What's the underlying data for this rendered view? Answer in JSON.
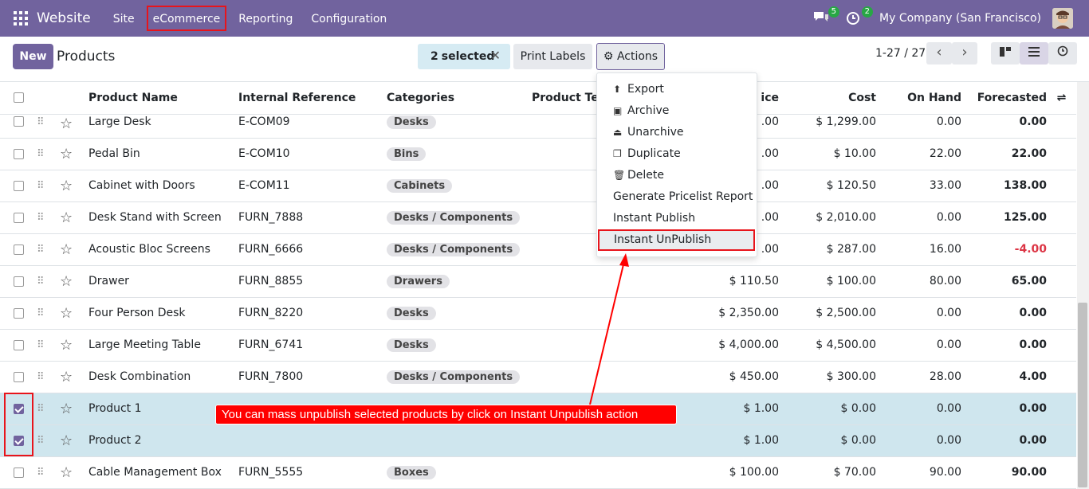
{
  "nav": {
    "brand": "Website",
    "menu": [
      "Site",
      "eCommerce",
      "Reporting",
      "Configuration"
    ],
    "messages_count": "5",
    "activity_count": "2",
    "company": "My Company (San Francisco)"
  },
  "control": {
    "new_label": "New",
    "title": "Products",
    "selected_count": "2",
    "selected_label": "selected",
    "print_labels": "Print Labels",
    "actions_label": "Actions",
    "pager": "1-27 / 27"
  },
  "columns": [
    "Product Name",
    "Internal Reference",
    "Categories",
    "Product Tem",
    "ice",
    "Cost",
    "On Hand",
    "Forecasted"
  ],
  "rows": [
    {
      "name": "Large Desk",
      "ref": "E-COM09",
      "cat": "Desks",
      "price": ".00",
      "cost": "$ 1,299.00",
      "onhand": "0.00",
      "forecast": "0.00"
    },
    {
      "name": "Pedal Bin",
      "ref": "E-COM10",
      "cat": "Bins",
      "price": ".00",
      "cost": "$ 10.00",
      "onhand": "22.00",
      "forecast": "22.00"
    },
    {
      "name": "Cabinet with Doors",
      "ref": "E-COM11",
      "cat": "Cabinets",
      "price": ".00",
      "cost": "$ 120.50",
      "onhand": "33.00",
      "forecast": "138.00"
    },
    {
      "name": "Desk Stand with Screen",
      "ref": "FURN_7888",
      "cat": "Desks / Components",
      "price": ".00",
      "cost": "$ 2,010.00",
      "onhand": "0.00",
      "forecast": "125.00"
    },
    {
      "name": "Acoustic Bloc Screens",
      "ref": "FURN_6666",
      "cat": "Desks / Components",
      "price": ".00",
      "cost": "$ 287.00",
      "onhand": "16.00",
      "forecast": "-4.00"
    },
    {
      "name": "Drawer",
      "ref": "FURN_8855",
      "cat": "Drawers",
      "price": "$ 110.50",
      "cost": "$ 100.00",
      "onhand": "80.00",
      "forecast": "65.00"
    },
    {
      "name": "Four Person Desk",
      "ref": "FURN_8220",
      "cat": "Desks",
      "price": "$ 2,350.00",
      "cost": "$ 2,500.00",
      "onhand": "0.00",
      "forecast": "0.00"
    },
    {
      "name": "Large Meeting Table",
      "ref": "FURN_6741",
      "cat": "Desks",
      "price": "$ 4,000.00",
      "cost": "$ 4,500.00",
      "onhand": "0.00",
      "forecast": "0.00"
    },
    {
      "name": "Desk Combination",
      "ref": "FURN_7800",
      "cat": "Desks / Components",
      "price": "$ 450.00",
      "cost": "$ 300.00",
      "onhand": "28.00",
      "forecast": "4.00"
    },
    {
      "name": "Product 1",
      "ref": "",
      "cat": "",
      "price": "$ 1.00",
      "cost": "$ 0.00",
      "onhand": "0.00",
      "forecast": "0.00"
    },
    {
      "name": "Product 2",
      "ref": "",
      "cat": "",
      "price": "$ 1.00",
      "cost": "$ 0.00",
      "onhand": "0.00",
      "forecast": "0.00"
    },
    {
      "name": "Cable Management Box",
      "ref": "FURN_5555",
      "cat": "Boxes",
      "price": "$ 100.00",
      "cost": "$ 70.00",
      "onhand": "90.00",
      "forecast": "90.00"
    }
  ],
  "actions_menu": [
    "Export",
    "Archive",
    "Unarchive",
    "Duplicate",
    "Delete",
    "Generate Pricelist Report",
    "Instant Publish",
    "Instant UnPublish"
  ],
  "annotation": "You can mass unpublish selected products by click on Instant Unpublish action",
  "colors": {
    "brand": "#71639e",
    "highlight": "#e8141b",
    "selected_row": "#cfe6ee"
  }
}
